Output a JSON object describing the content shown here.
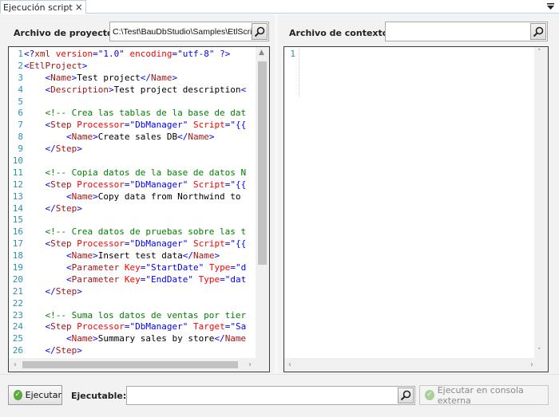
{
  "tab": {
    "label": "Ejecución script",
    "close_glyph": "×"
  },
  "tab_dropdown_icon": "chevron-down-icon",
  "project": {
    "label": "Archivo de proyecto:",
    "path": "C:\\Test\\BauDbStudio\\Samples\\EtlScri"
  },
  "context": {
    "label": "Archivo de contexto:",
    "path": ""
  },
  "colors": {
    "tag": "#a31515",
    "bracket": "#0000ff",
    "attribute": "#ff0000",
    "value": "#0000ff",
    "comment": "#008000",
    "line_number": "#2b91af",
    "ok_green": "#5aaa3c"
  },
  "editor_left": {
    "line_numbers": [
      "1",
      "2",
      "3",
      "4",
      "5",
      "6",
      "7",
      "8",
      "9",
      "10",
      "11",
      "12",
      "13",
      "14",
      "15",
      "16",
      "17",
      "18",
      "19",
      "20",
      "21",
      "22",
      "23",
      "24",
      "25",
      "26"
    ],
    "lines": [
      "<?xml version=\"1.0\" encoding=\"utf-8\" ?>",
      "<EtlProject>",
      "    <Name>Test project</Name>",
      "    <Description>Test project description<",
      "",
      "    <!-- Crea las tablas de la base de dat",
      "    <Step Processor=\"DbManager\" Script=\"{{",
      "        <Name>Create sales DB</Name>",
      "    </Step>",
      "",
      "    <!-- Copia datos de la base de datos N",
      "    <Step Processor=\"DbManager\" Script=\"{{",
      "        <Name>Copy data from Northwind to",
      "    </Step>",
      "",
      "    <!-- Crea datos de pruebas sobre las t",
      "    <Step Processor=\"DbManager\" Script=\"{{",
      "        <Name>Insert test data</Name>",
      "        <Parameter Key=\"StartDate\" Type=\"d",
      "        <Parameter Key=\"EndDate\" Type=\"dat",
      "    </Step>",
      "",
      "    <!-- Suma los datos de ventas por tier",
      "    <Step Processor=\"DbManager\" Target=\"Sa",
      "        <Name>Summary sales by store</Name",
      "    </Step>"
    ]
  },
  "editor_right": {
    "line_numbers": [
      "1"
    ]
  },
  "bottom": {
    "run_label": "Ejecutar",
    "executable_label": "Ejecutable:",
    "executable_value": "",
    "console_label": "Ejecutar en consola externa"
  }
}
